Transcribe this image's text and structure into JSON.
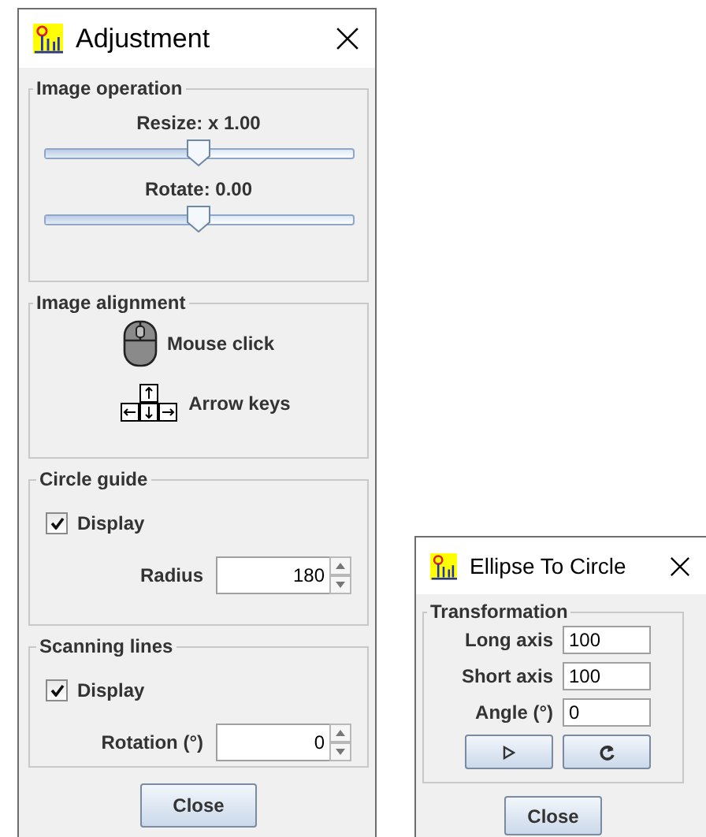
{
  "adjustment_window": {
    "title": "Adjustment",
    "image_operation": {
      "title": "Image operation",
      "sliders": [
        {
          "label": "Resize: x 1.00",
          "level": 0.5
        },
        {
          "label": "Rotate: 0.00",
          "level": 0.5
        }
      ]
    },
    "image_alignment": {
      "title": "Image alignment",
      "items": [
        {
          "kind": "mouse",
          "label": "Mouse click"
        },
        {
          "kind": "keys",
          "label": "Arrow keys"
        }
      ]
    },
    "circle_guide": {
      "title": "Circle guide",
      "display": {
        "label": "Display",
        "checked": true
      },
      "field": {
        "label": "Radius",
        "value": "180"
      }
    },
    "scanning_lines": {
      "title": "Scanning lines",
      "display": {
        "label": "Display",
        "checked": true
      },
      "field": {
        "label": "Rotation (°)",
        "value": "0"
      }
    },
    "close_button": "Close"
  },
  "ellipse_window": {
    "title": "Ellipse To Circle",
    "group_title": "Transformation",
    "fields": [
      {
        "label": "Long axis",
        "value": "100"
      },
      {
        "label": "Short axis",
        "value": "100"
      },
      {
        "label": "Angle (°)",
        "value": "0"
      }
    ],
    "buttons": [
      {
        "kind": "play"
      },
      {
        "kind": "rotate"
      }
    ],
    "close_button": "Close"
  }
}
